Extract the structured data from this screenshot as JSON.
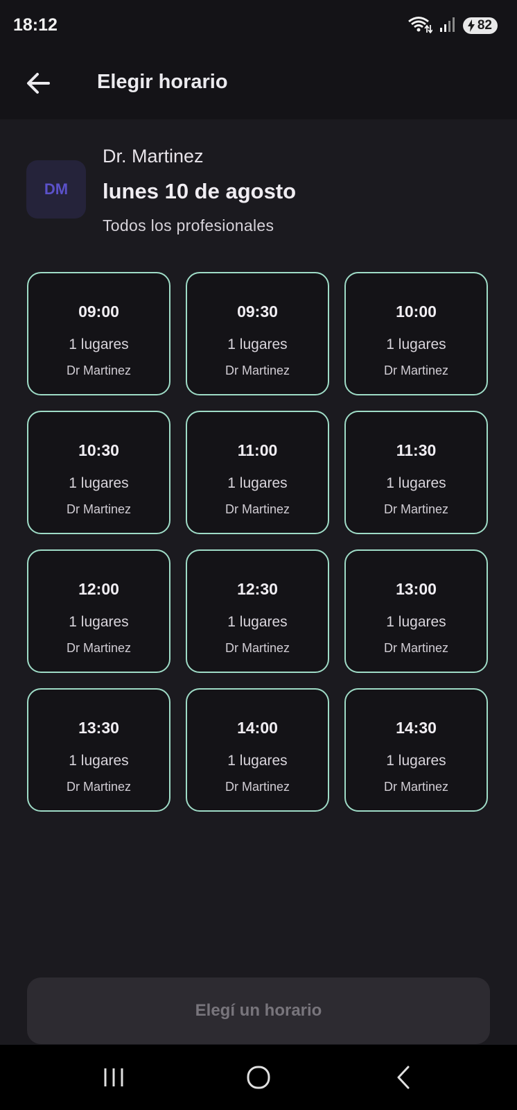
{
  "status_bar": {
    "time": "18:12",
    "battery": "82",
    "icons": [
      "wifi-icon",
      "signal-icon",
      "battery-charging-icon"
    ]
  },
  "app_bar": {
    "title": "Elegir horario",
    "back_icon": "arrow-left-icon"
  },
  "header": {
    "avatar_initials": "DM",
    "doctor_name": "Dr. Martinez",
    "date": "lunes 10 de agosto",
    "subtitle": "Todos los profesionales"
  },
  "slots": [
    {
      "time": "09:00",
      "places": "1 lugares",
      "doctor": "Dr Martinez"
    },
    {
      "time": "09:30",
      "places": "1 lugares",
      "doctor": "Dr Martinez"
    },
    {
      "time": "10:00",
      "places": "1 lugares",
      "doctor": "Dr Martinez"
    },
    {
      "time": "10:30",
      "places": "1 lugares",
      "doctor": "Dr Martinez"
    },
    {
      "time": "11:00",
      "places": "1 lugares",
      "doctor": "Dr Martinez"
    },
    {
      "time": "11:30",
      "places": "1 lugares",
      "doctor": "Dr Martinez"
    },
    {
      "time": "12:00",
      "places": "1 lugares",
      "doctor": "Dr Martinez"
    },
    {
      "time": "12:30",
      "places": "1 lugares",
      "doctor": "Dr Martinez"
    },
    {
      "time": "13:00",
      "places": "1 lugares",
      "doctor": "Dr Martinez"
    },
    {
      "time": "13:30",
      "places": "1 lugares",
      "doctor": "Dr Martinez"
    },
    {
      "time": "14:00",
      "places": "1 lugares",
      "doctor": "Dr Martinez"
    },
    {
      "time": "14:30",
      "places": "1 lugares",
      "doctor": "Dr Martinez"
    }
  ],
  "cta": {
    "label": "Elegí un horario"
  },
  "nav_bar": {
    "icons": [
      "recents-icon",
      "home-icon",
      "back-icon"
    ]
  },
  "colors": {
    "background": "#1b1a1f",
    "slot_border": "#9fdcc7",
    "avatar_bg": "#25233a",
    "avatar_text": "#5b51c9",
    "cta_bg": "#2d2b31",
    "cta_text": "#78757c"
  }
}
